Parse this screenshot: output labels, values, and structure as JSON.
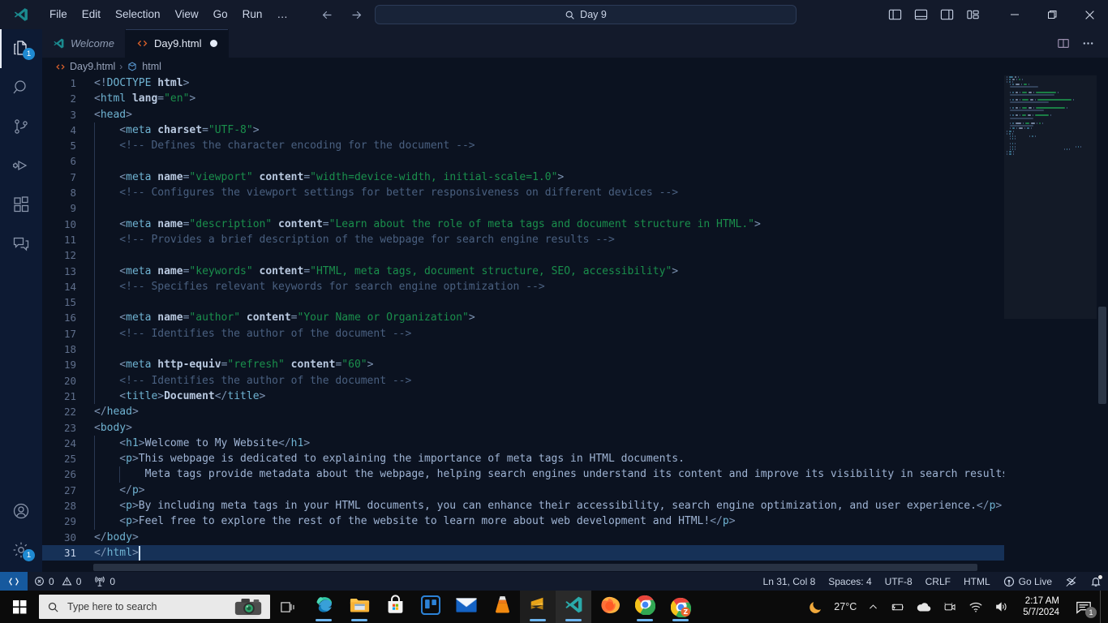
{
  "titlebar": {
    "logo_icon": "vscode-logo-icon",
    "menu": [
      {
        "label": "File"
      },
      {
        "label": "Edit"
      },
      {
        "label": "Selection"
      },
      {
        "label": "View"
      },
      {
        "label": "Go"
      },
      {
        "label": "Run"
      },
      {
        "label": "…"
      }
    ],
    "nav_back_icon": "arrow-left-icon",
    "nav_forward_icon": "arrow-right-icon",
    "command_center": {
      "icon": "search-icon",
      "value": "Day 9"
    },
    "layout_buttons": [
      {
        "name": "toggle-primary-sidebar"
      },
      {
        "name": "toggle-panel"
      },
      {
        "name": "toggle-secondary-sidebar"
      },
      {
        "name": "customize-layout"
      }
    ],
    "window_controls": {
      "minimize": "—",
      "maximize": "❐",
      "close": "✕"
    }
  },
  "activitybar": {
    "items": [
      {
        "name": "explorer",
        "icon": "files-icon",
        "badge": "1",
        "active": true
      },
      {
        "name": "search",
        "icon": "search-icon",
        "badge": "",
        "active": false
      },
      {
        "name": "source-control",
        "icon": "source-control-icon",
        "badge": "",
        "active": false
      },
      {
        "name": "run-and-debug",
        "icon": "run-debug-icon",
        "badge": "",
        "active": false
      },
      {
        "name": "extensions",
        "icon": "extensions-icon",
        "badge": "",
        "active": false
      },
      {
        "name": "chat",
        "icon": "comments-icon",
        "badge": "",
        "active": false
      }
    ],
    "bottom_items": [
      {
        "name": "accounts",
        "icon": "account-icon",
        "badge": ""
      },
      {
        "name": "manage-settings",
        "icon": "gear-icon",
        "badge": "1"
      }
    ]
  },
  "tabs": [
    {
      "label": "Welcome",
      "icon": "vscode-logo-icon",
      "active": false,
      "dirty": false
    },
    {
      "label": "Day9.html",
      "icon": "html-file-icon",
      "active": true,
      "dirty": true
    }
  ],
  "tabbar_actions": [
    {
      "name": "split-editor-right",
      "icon": "split-editor-icon"
    },
    {
      "name": "more-actions",
      "icon": "ellipsis-icon"
    }
  ],
  "breadcrumb": {
    "file_icon": "html-file-icon",
    "file": "Day9.html",
    "separator": "›",
    "symbol_icon": "symbol-field-icon",
    "symbol": "html"
  },
  "editor": {
    "cursor_line": 31,
    "selected_line": 31,
    "lines": [
      {
        "n": 1,
        "indent": 0,
        "tokens": [
          {
            "c": "t-punc",
            "t": "<!"
          },
          {
            "c": "t-doct",
            "t": "DOCTYPE"
          },
          {
            "c": "t-punc",
            "t": " "
          },
          {
            "c": "t-doctn",
            "t": "html"
          },
          {
            "c": "t-punc",
            "t": ">"
          }
        ]
      },
      {
        "n": 2,
        "indent": 0,
        "tokens": [
          {
            "c": "t-punc",
            "t": "<"
          },
          {
            "c": "t-tag",
            "t": "html"
          },
          {
            "c": "t-punc",
            "t": " "
          },
          {
            "c": "t-attr",
            "t": "lang"
          },
          {
            "c": "t-punc",
            "t": "="
          },
          {
            "c": "t-str",
            "t": "\"en\""
          },
          {
            "c": "t-punc",
            "t": ">"
          }
        ]
      },
      {
        "n": 3,
        "indent": 0,
        "tokens": [
          {
            "c": "t-punc",
            "t": "<"
          },
          {
            "c": "t-tag",
            "t": "head"
          },
          {
            "c": "t-punc",
            "t": ">"
          }
        ]
      },
      {
        "n": 4,
        "indent": 1,
        "tokens": [
          {
            "c": "t-punc",
            "t": "    <"
          },
          {
            "c": "t-tag",
            "t": "meta"
          },
          {
            "c": "t-punc",
            "t": " "
          },
          {
            "c": "t-attr",
            "t": "charset"
          },
          {
            "c": "t-punc",
            "t": "="
          },
          {
            "c": "t-str",
            "t": "\"UTF-8\""
          },
          {
            "c": "t-punc",
            "t": ">"
          }
        ]
      },
      {
        "n": 5,
        "indent": 1,
        "tokens": [
          {
            "c": "t-cmt",
            "t": "    <!-- Defines the character encoding for the document -->"
          }
        ]
      },
      {
        "n": 6,
        "indent": 1,
        "tokens": [
          {
            "c": "t-punc",
            "t": ""
          }
        ]
      },
      {
        "n": 7,
        "indent": 1,
        "tokens": [
          {
            "c": "t-punc",
            "t": "    <"
          },
          {
            "c": "t-tag",
            "t": "meta"
          },
          {
            "c": "t-punc",
            "t": " "
          },
          {
            "c": "t-attr",
            "t": "name"
          },
          {
            "c": "t-punc",
            "t": "="
          },
          {
            "c": "t-str",
            "t": "\"viewport\""
          },
          {
            "c": "t-punc",
            "t": " "
          },
          {
            "c": "t-attr",
            "t": "content"
          },
          {
            "c": "t-punc",
            "t": "="
          },
          {
            "c": "t-str",
            "t": "\"width=device-width, initial-scale=1.0\""
          },
          {
            "c": "t-punc",
            "t": ">"
          }
        ]
      },
      {
        "n": 8,
        "indent": 1,
        "tokens": [
          {
            "c": "t-cmt",
            "t": "    <!-- Configures the viewport settings for better responsiveness on different devices -->"
          }
        ]
      },
      {
        "n": 9,
        "indent": 1,
        "tokens": [
          {
            "c": "t-punc",
            "t": ""
          }
        ]
      },
      {
        "n": 10,
        "indent": 1,
        "tokens": [
          {
            "c": "t-punc",
            "t": "    <"
          },
          {
            "c": "t-tag",
            "t": "meta"
          },
          {
            "c": "t-punc",
            "t": " "
          },
          {
            "c": "t-attr",
            "t": "name"
          },
          {
            "c": "t-punc",
            "t": "="
          },
          {
            "c": "t-str",
            "t": "\"description\""
          },
          {
            "c": "t-punc",
            "t": " "
          },
          {
            "c": "t-attr",
            "t": "content"
          },
          {
            "c": "t-punc",
            "t": "="
          },
          {
            "c": "t-str",
            "t": "\"Learn about the role of meta tags and document structure in HTML.\""
          },
          {
            "c": "t-punc",
            "t": ">"
          }
        ]
      },
      {
        "n": 11,
        "indent": 1,
        "tokens": [
          {
            "c": "t-cmt",
            "t": "    <!-- Provides a brief description of the webpage for search engine results -->"
          }
        ]
      },
      {
        "n": 12,
        "indent": 1,
        "tokens": [
          {
            "c": "t-punc",
            "t": ""
          }
        ]
      },
      {
        "n": 13,
        "indent": 1,
        "tokens": [
          {
            "c": "t-punc",
            "t": "    <"
          },
          {
            "c": "t-tag",
            "t": "meta"
          },
          {
            "c": "t-punc",
            "t": " "
          },
          {
            "c": "t-attr",
            "t": "name"
          },
          {
            "c": "t-punc",
            "t": "="
          },
          {
            "c": "t-str",
            "t": "\"keywords\""
          },
          {
            "c": "t-punc",
            "t": " "
          },
          {
            "c": "t-attr",
            "t": "content"
          },
          {
            "c": "t-punc",
            "t": "="
          },
          {
            "c": "t-str",
            "t": "\"HTML, meta tags, document structure, SEO, accessibility\""
          },
          {
            "c": "t-punc",
            "t": ">"
          }
        ]
      },
      {
        "n": 14,
        "indent": 1,
        "tokens": [
          {
            "c": "t-cmt",
            "t": "    <!-- Specifies relevant keywords for search engine optimization -->"
          }
        ]
      },
      {
        "n": 15,
        "indent": 1,
        "tokens": [
          {
            "c": "t-punc",
            "t": ""
          }
        ]
      },
      {
        "n": 16,
        "indent": 1,
        "tokens": [
          {
            "c": "t-punc",
            "t": "    <"
          },
          {
            "c": "t-tag",
            "t": "meta"
          },
          {
            "c": "t-punc",
            "t": " "
          },
          {
            "c": "t-attr",
            "t": "name"
          },
          {
            "c": "t-punc",
            "t": "="
          },
          {
            "c": "t-str",
            "t": "\"author\""
          },
          {
            "c": "t-punc",
            "t": " "
          },
          {
            "c": "t-attr",
            "t": "content"
          },
          {
            "c": "t-punc",
            "t": "="
          },
          {
            "c": "t-str",
            "t": "\"Your Name or Organization\""
          },
          {
            "c": "t-punc",
            "t": ">"
          }
        ]
      },
      {
        "n": 17,
        "indent": 1,
        "tokens": [
          {
            "c": "t-cmt",
            "t": "    <!-- Identifies the author of the document -->"
          }
        ]
      },
      {
        "n": 18,
        "indent": 1,
        "tokens": [
          {
            "c": "t-punc",
            "t": ""
          }
        ]
      },
      {
        "n": 19,
        "indent": 1,
        "tokens": [
          {
            "c": "t-punc",
            "t": "    <"
          },
          {
            "c": "t-tag",
            "t": "meta"
          },
          {
            "c": "t-punc",
            "t": " "
          },
          {
            "c": "t-attr",
            "t": "http-equiv"
          },
          {
            "c": "t-punc",
            "t": "="
          },
          {
            "c": "t-str",
            "t": "\"refresh\""
          },
          {
            "c": "t-punc",
            "t": " "
          },
          {
            "c": "t-attr",
            "t": "content"
          },
          {
            "c": "t-punc",
            "t": "="
          },
          {
            "c": "t-str",
            "t": "\"60\""
          },
          {
            "c": "t-punc",
            "t": ">"
          }
        ]
      },
      {
        "n": 20,
        "indent": 1,
        "tokens": [
          {
            "c": "t-cmt",
            "t": "    <!-- Identifies the author of the document -->"
          }
        ]
      },
      {
        "n": 21,
        "indent": 1,
        "tokens": [
          {
            "c": "t-punc",
            "t": "    <"
          },
          {
            "c": "t-tag",
            "t": "title"
          },
          {
            "c": "t-punc",
            "t": ">"
          },
          {
            "c": "t-attr",
            "t": "Document"
          },
          {
            "c": "t-punc",
            "t": "</"
          },
          {
            "c": "t-tag",
            "t": "title"
          },
          {
            "c": "t-punc",
            "t": ">"
          }
        ]
      },
      {
        "n": 22,
        "indent": 0,
        "tokens": [
          {
            "c": "t-punc",
            "t": "</"
          },
          {
            "c": "t-tag",
            "t": "head"
          },
          {
            "c": "t-punc",
            "t": ">"
          }
        ]
      },
      {
        "n": 23,
        "indent": 0,
        "tokens": [
          {
            "c": "t-punc",
            "t": "<"
          },
          {
            "c": "t-tag",
            "t": "body"
          },
          {
            "c": "t-punc",
            "t": ">"
          }
        ]
      },
      {
        "n": 24,
        "indent": 1,
        "tokens": [
          {
            "c": "t-punc",
            "t": "    <"
          },
          {
            "c": "t-tag",
            "t": "h1"
          },
          {
            "c": "t-punc",
            "t": ">"
          },
          {
            "c": "t-text",
            "t": "Welcome to My Website"
          },
          {
            "c": "t-punc",
            "t": "</"
          },
          {
            "c": "t-tag",
            "t": "h1"
          },
          {
            "c": "t-punc",
            "t": ">"
          }
        ]
      },
      {
        "n": 25,
        "indent": 1,
        "tokens": [
          {
            "c": "t-punc",
            "t": "    <"
          },
          {
            "c": "t-tag",
            "t": "p"
          },
          {
            "c": "t-punc",
            "t": ">"
          },
          {
            "c": "t-text",
            "t": "This webpage is dedicated to explaining the importance of meta tags in HTML documents."
          }
        ]
      },
      {
        "n": 26,
        "indent": 2,
        "tokens": [
          {
            "c": "t-text",
            "t": "        Meta tags provide metadata about the webpage, helping search engines understand its content and improve its visibility in search results."
          }
        ]
      },
      {
        "n": 27,
        "indent": 1,
        "tokens": [
          {
            "c": "t-punc",
            "t": "    </"
          },
          {
            "c": "t-tag",
            "t": "p"
          },
          {
            "c": "t-punc",
            "t": ">"
          }
        ]
      },
      {
        "n": 28,
        "indent": 1,
        "tokens": [
          {
            "c": "t-punc",
            "t": "    <"
          },
          {
            "c": "t-tag",
            "t": "p"
          },
          {
            "c": "t-punc",
            "t": ">"
          },
          {
            "c": "t-text",
            "t": "By including meta tags in your HTML documents, you can enhance their accessibility, search engine optimization, and user experience."
          },
          {
            "c": "t-punc",
            "t": "</"
          },
          {
            "c": "t-tag",
            "t": "p"
          },
          {
            "c": "t-punc",
            "t": ">"
          }
        ]
      },
      {
        "n": 29,
        "indent": 1,
        "tokens": [
          {
            "c": "t-punc",
            "t": "    <"
          },
          {
            "c": "t-tag",
            "t": "p"
          },
          {
            "c": "t-punc",
            "t": ">"
          },
          {
            "c": "t-text",
            "t": "Feel free to explore the rest of the website to learn more about web development and HTML!"
          },
          {
            "c": "t-punc",
            "t": "</"
          },
          {
            "c": "t-tag",
            "t": "p"
          },
          {
            "c": "t-punc",
            "t": ">"
          }
        ]
      },
      {
        "n": 30,
        "indent": 0,
        "tokens": [
          {
            "c": "t-punc",
            "t": "</"
          },
          {
            "c": "t-tag",
            "t": "body"
          },
          {
            "c": "t-punc",
            "t": ">"
          }
        ]
      },
      {
        "n": 31,
        "indent": 0,
        "tokens": [
          {
            "c": "t-punc",
            "t": "</"
          },
          {
            "c": "t-tag",
            "t": "html"
          },
          {
            "c": "t-punc",
            "t": ">"
          }
        ]
      }
    ]
  },
  "statusbar": {
    "remote_icon": "remote-window-icon",
    "left": [
      {
        "name": "problems-errors",
        "icon": "error-circle-icon",
        "label": "0"
      },
      {
        "name": "problems-warnings",
        "icon": "warning-triangle-icon",
        "label": "0"
      },
      {
        "name": "ports",
        "icon": "radio-tower-icon",
        "label": "0"
      }
    ],
    "right": [
      {
        "name": "editor-position",
        "label": "Ln 31, Col 8"
      },
      {
        "name": "editor-indentation",
        "label": "Spaces: 4"
      },
      {
        "name": "editor-encoding",
        "label": "UTF-8"
      },
      {
        "name": "editor-eol",
        "label": "CRLF"
      },
      {
        "name": "editor-language",
        "label": "HTML"
      },
      {
        "name": "go-live",
        "icon": "broadcast-icon",
        "label": "Go Live"
      },
      {
        "name": "intellicode",
        "icon": "intellicode-icon",
        "label": ""
      },
      {
        "name": "notifications",
        "icon": "bell-dot-icon",
        "label": ""
      }
    ]
  },
  "taskbar": {
    "start_icon": "windows-start-icon",
    "search": {
      "icon": "search-icon",
      "placeholder": "Type here to search",
      "camera_icon": "camera-icon"
    },
    "taskview_icon": "task-view-icon",
    "apps": [
      {
        "name": "microsoft-edge",
        "icon": "edge-icon",
        "running": true,
        "focused": false
      },
      {
        "name": "file-explorer",
        "icon": "folder-icon",
        "running": true,
        "focused": false
      },
      {
        "name": "microsoft-store",
        "icon": "store-icon",
        "running": false,
        "focused": false
      },
      {
        "name": "trello",
        "icon": "trello-icon",
        "running": false,
        "focused": false
      },
      {
        "name": "mail",
        "icon": "mail-icon",
        "running": false,
        "focused": false
      },
      {
        "name": "vlc-media-player",
        "icon": "vlc-cone-icon",
        "running": false,
        "focused": false
      },
      {
        "name": "sublime-text",
        "icon": "sublime-icon",
        "running": true,
        "focused": false
      },
      {
        "name": "visual-studio-code",
        "icon": "vscode-logo-icon",
        "running": true,
        "focused": true
      },
      {
        "name": "firefox",
        "icon": "firefox-icon",
        "running": false,
        "focused": false
      },
      {
        "name": "google-chrome",
        "icon": "chrome-icon",
        "running": true,
        "focused": false
      },
      {
        "name": "chrome-zoom",
        "icon": "zoom-chrome-icon",
        "running": true,
        "focused": false
      }
    ],
    "tray": {
      "weather_icon": "moon-icon",
      "weather_temp": "27°C",
      "chevron_icon": "chevron-up-icon",
      "icons": [
        {
          "name": "battery-icon"
        },
        {
          "name": "onedrive-cloud-icon"
        },
        {
          "name": "camera-privacy-icon"
        },
        {
          "name": "wifi-icon"
        },
        {
          "name": "volume-icon"
        }
      ],
      "time": "2:17 AM",
      "date": "5/7/2024",
      "notification_icon": "notification-icon",
      "notification_count": "1"
    }
  },
  "colors": {
    "accent": "#1f8ad2",
    "editor_bg": "#0b1220",
    "chrome_bg": "#131a2b",
    "activitybar_bg": "#0d1a33",
    "selection": "#163157"
  }
}
